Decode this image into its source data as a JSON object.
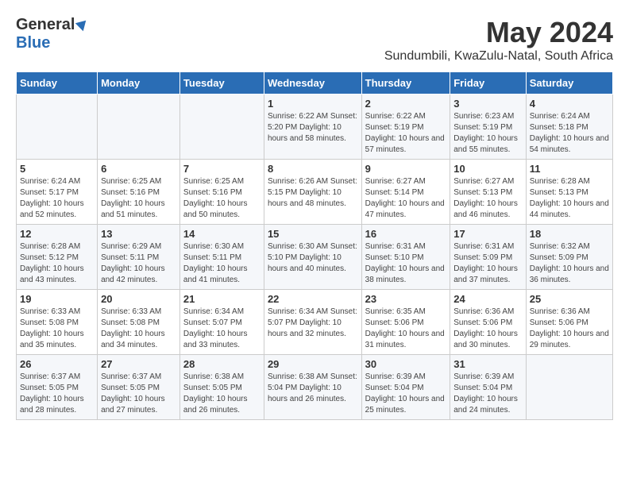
{
  "logo": {
    "general": "General",
    "blue": "Blue"
  },
  "title": "May 2024",
  "subtitle": "Sundumbili, KwaZulu-Natal, South Africa",
  "days_header": [
    "Sunday",
    "Monday",
    "Tuesday",
    "Wednesday",
    "Thursday",
    "Friday",
    "Saturday"
  ],
  "weeks": [
    [
      {
        "day": "",
        "info": ""
      },
      {
        "day": "",
        "info": ""
      },
      {
        "day": "",
        "info": ""
      },
      {
        "day": "1",
        "info": "Sunrise: 6:22 AM\nSunset: 5:20 PM\nDaylight: 10 hours and 58 minutes."
      },
      {
        "day": "2",
        "info": "Sunrise: 6:22 AM\nSunset: 5:19 PM\nDaylight: 10 hours and 57 minutes."
      },
      {
        "day": "3",
        "info": "Sunrise: 6:23 AM\nSunset: 5:19 PM\nDaylight: 10 hours and 55 minutes."
      },
      {
        "day": "4",
        "info": "Sunrise: 6:24 AM\nSunset: 5:18 PM\nDaylight: 10 hours and 54 minutes."
      }
    ],
    [
      {
        "day": "5",
        "info": "Sunrise: 6:24 AM\nSunset: 5:17 PM\nDaylight: 10 hours and 52 minutes."
      },
      {
        "day": "6",
        "info": "Sunrise: 6:25 AM\nSunset: 5:16 PM\nDaylight: 10 hours and 51 minutes."
      },
      {
        "day": "7",
        "info": "Sunrise: 6:25 AM\nSunset: 5:16 PM\nDaylight: 10 hours and 50 minutes."
      },
      {
        "day": "8",
        "info": "Sunrise: 6:26 AM\nSunset: 5:15 PM\nDaylight: 10 hours and 48 minutes."
      },
      {
        "day": "9",
        "info": "Sunrise: 6:27 AM\nSunset: 5:14 PM\nDaylight: 10 hours and 47 minutes."
      },
      {
        "day": "10",
        "info": "Sunrise: 6:27 AM\nSunset: 5:13 PM\nDaylight: 10 hours and 46 minutes."
      },
      {
        "day": "11",
        "info": "Sunrise: 6:28 AM\nSunset: 5:13 PM\nDaylight: 10 hours and 44 minutes."
      }
    ],
    [
      {
        "day": "12",
        "info": "Sunrise: 6:28 AM\nSunset: 5:12 PM\nDaylight: 10 hours and 43 minutes."
      },
      {
        "day": "13",
        "info": "Sunrise: 6:29 AM\nSunset: 5:11 PM\nDaylight: 10 hours and 42 minutes."
      },
      {
        "day": "14",
        "info": "Sunrise: 6:30 AM\nSunset: 5:11 PM\nDaylight: 10 hours and 41 minutes."
      },
      {
        "day": "15",
        "info": "Sunrise: 6:30 AM\nSunset: 5:10 PM\nDaylight: 10 hours and 40 minutes."
      },
      {
        "day": "16",
        "info": "Sunrise: 6:31 AM\nSunset: 5:10 PM\nDaylight: 10 hours and 38 minutes."
      },
      {
        "day": "17",
        "info": "Sunrise: 6:31 AM\nSunset: 5:09 PM\nDaylight: 10 hours and 37 minutes."
      },
      {
        "day": "18",
        "info": "Sunrise: 6:32 AM\nSunset: 5:09 PM\nDaylight: 10 hours and 36 minutes."
      }
    ],
    [
      {
        "day": "19",
        "info": "Sunrise: 6:33 AM\nSunset: 5:08 PM\nDaylight: 10 hours and 35 minutes."
      },
      {
        "day": "20",
        "info": "Sunrise: 6:33 AM\nSunset: 5:08 PM\nDaylight: 10 hours and 34 minutes."
      },
      {
        "day": "21",
        "info": "Sunrise: 6:34 AM\nSunset: 5:07 PM\nDaylight: 10 hours and 33 minutes."
      },
      {
        "day": "22",
        "info": "Sunrise: 6:34 AM\nSunset: 5:07 PM\nDaylight: 10 hours and 32 minutes."
      },
      {
        "day": "23",
        "info": "Sunrise: 6:35 AM\nSunset: 5:06 PM\nDaylight: 10 hours and 31 minutes."
      },
      {
        "day": "24",
        "info": "Sunrise: 6:36 AM\nSunset: 5:06 PM\nDaylight: 10 hours and 30 minutes."
      },
      {
        "day": "25",
        "info": "Sunrise: 6:36 AM\nSunset: 5:06 PM\nDaylight: 10 hours and 29 minutes."
      }
    ],
    [
      {
        "day": "26",
        "info": "Sunrise: 6:37 AM\nSunset: 5:05 PM\nDaylight: 10 hours and 28 minutes."
      },
      {
        "day": "27",
        "info": "Sunrise: 6:37 AM\nSunset: 5:05 PM\nDaylight: 10 hours and 27 minutes."
      },
      {
        "day": "28",
        "info": "Sunrise: 6:38 AM\nSunset: 5:05 PM\nDaylight: 10 hours and 26 minutes."
      },
      {
        "day": "29",
        "info": "Sunrise: 6:38 AM\nSunset: 5:04 PM\nDaylight: 10 hours and 26 minutes."
      },
      {
        "day": "30",
        "info": "Sunrise: 6:39 AM\nSunset: 5:04 PM\nDaylight: 10 hours and 25 minutes."
      },
      {
        "day": "31",
        "info": "Sunrise: 6:39 AM\nSunset: 5:04 PM\nDaylight: 10 hours and 24 minutes."
      },
      {
        "day": "",
        "info": ""
      }
    ]
  ]
}
